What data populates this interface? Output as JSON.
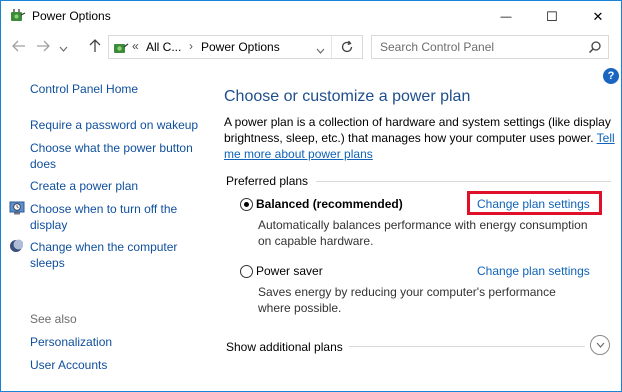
{
  "window": {
    "title": "Power Options",
    "minimize_glyph": "—",
    "maximize_glyph": "☐",
    "close_glyph": "✕"
  },
  "address": {
    "back_icon": "arrow-left-icon",
    "forward_icon": "arrow-right-icon",
    "recent_icon": "chevron-down-icon",
    "up_icon": "arrow-up-icon",
    "overflow": "«",
    "crumb1": "All C...",
    "crumb_sep": "›",
    "crumb2": "Power Options",
    "search_placeholder": "Search Control Panel"
  },
  "sidebar": {
    "home": "Control Panel Home",
    "links": [
      "Require a password on wakeup",
      "Choose what the power button does",
      "Create a power plan",
      "Choose when to turn off the display",
      "Change when the computer sleeps"
    ],
    "see_also": "See also",
    "see_also_links": [
      "Personalization",
      "User Accounts"
    ]
  },
  "main": {
    "heading": "Choose or customize a power plan",
    "description": "A power plan is a collection of hardware and system settings (like display brightness, sleep, etc.) that manages how your computer uses power.",
    "tell_me_more": "Tell me more about power plans",
    "preferred_plans": "Preferred plans",
    "plans": [
      {
        "name": "Balanced (recommended)",
        "selected": true,
        "description": "Automatically balances performance with energy consumption on capable hardware.",
        "link": "Change plan settings"
      },
      {
        "name": "Power saver",
        "selected": false,
        "description": "Saves energy by reducing your computer's performance where possible.",
        "link": "Change plan settings"
      }
    ],
    "show_additional": "Show additional plans"
  },
  "colors": {
    "heading": "#1e4e8c",
    "link": "#0f63b8",
    "highlight_box": "#e0102a",
    "window_border": "#1883d7"
  }
}
